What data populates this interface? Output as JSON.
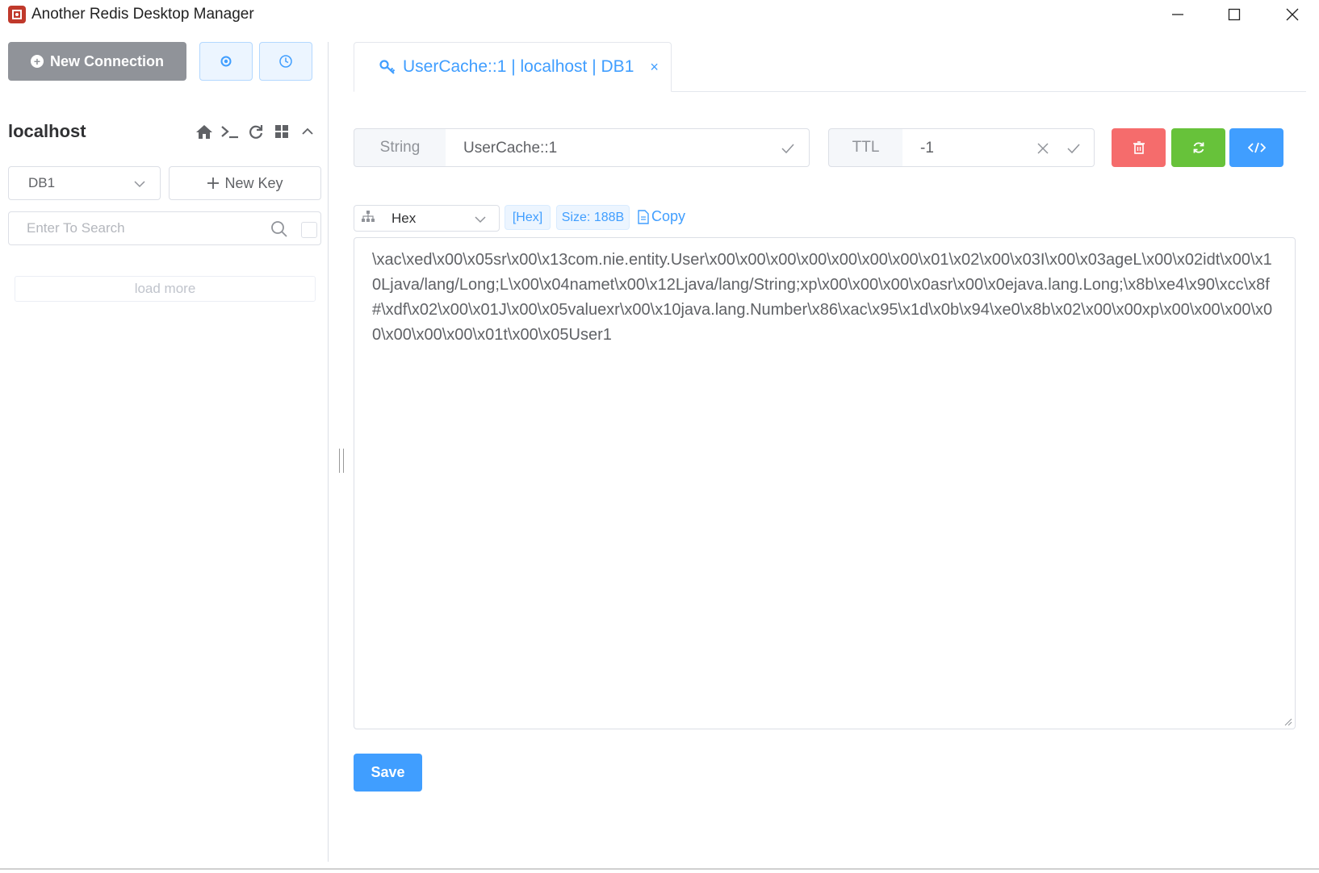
{
  "window": {
    "app_icon": "redis-logo-icon",
    "title": "Another Redis Desktop Manager"
  },
  "sidebar": {
    "new_connection_label": "New Connection",
    "connection_name": "localhost",
    "db_select_value": "DB1",
    "new_key_label": "New Key",
    "search_placeholder": "Enter To Search",
    "load_more_label": "load more"
  },
  "tab": {
    "label": "UserCache::1 | localhost | DB1",
    "close_glyph": "×"
  },
  "key_bar": {
    "type_label": "String",
    "key_value": "UserCache::1",
    "ttl_label": "TTL",
    "ttl_value": "-1"
  },
  "viewer": {
    "format_value": "Hex",
    "hex_tag": "[Hex]",
    "size_tag": "Size: 188B",
    "copy_label": "Copy",
    "content": "\\xac\\xed\\x00\\x05sr\\x00\\x13com.nie.entity.User\\x00\\x00\\x00\\x00\\x00\\x00\\x00\\x01\\x02\\x00\\x03I\\x00\\x03ageL\\x00\\x02idt\\x00\\x10Ljava/lang/Long;L\\x00\\x04namet\\x00\\x12Ljava/lang/String;xp\\x00\\x00\\x00\\x0asr\\x00\\x0ejava.lang.Long;\\x8b\\xe4\\x90\\xcc\\x8f#\\xdf\\x02\\x00\\x01J\\x00\\x05valuexr\\x00\\x10java.lang.Number\\x86\\xac\\x95\\x1d\\x0b\\x94\\xe0\\x8b\\x02\\x00\\x00xp\\x00\\x00\\x00\\x00\\x00\\x00\\x00\\x01t\\x00\\x05User1",
    "save_label": "Save"
  },
  "colors": {
    "primary": "#409eff",
    "danger": "#f56c6c",
    "success": "#67c23a",
    "info": "#909399"
  }
}
